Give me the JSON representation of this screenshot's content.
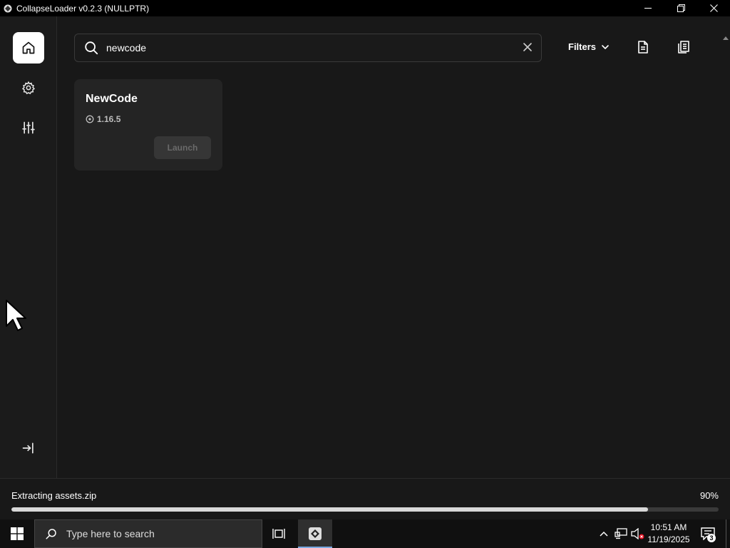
{
  "window": {
    "title": "CollapseLoader v0.2.3 (NULLPTR)"
  },
  "icons": {
    "app": "collapse-diamond-icon",
    "minimize": "minimize-icon",
    "restore": "restore-icon",
    "close": "close-icon",
    "home": "home-icon",
    "settings": "gear-icon",
    "customize": "sliders-icon",
    "logout": "login-arrow-icon",
    "search": "search-icon",
    "clear": "clear-icon",
    "chevron": "chevron-down-icon",
    "logs": "document-icon",
    "news": "documents-stack-icon",
    "version": "clock-icon"
  },
  "search": {
    "value": "newcode",
    "placeholder": ""
  },
  "toolbar": {
    "filters_label": "Filters"
  },
  "clients": [
    {
      "name": "NewCode",
      "version": "1.16.5",
      "launch_label": "Launch",
      "launch_enabled": false
    }
  ],
  "status": {
    "message": "Extracting assets.zip",
    "percent_label": "90%",
    "progress": 0.9
  },
  "taskbar": {
    "search_placeholder": "Type here to search",
    "time": "10:51 AM",
    "date": "11/19/2025",
    "notification_count": "3"
  },
  "colors": {
    "accent": "#ffffff",
    "background": "#181818",
    "card": "#242424",
    "progress_fill": "#d8d8d8"
  }
}
